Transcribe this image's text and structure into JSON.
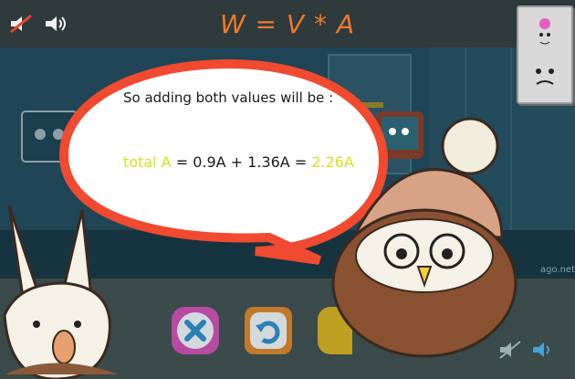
{
  "header": {
    "title": "W = V * A",
    "sound_mute_icon": "speaker-mute-icon",
    "sound_on_icon": "speaker-on-icon"
  },
  "dialog": {
    "line1": "So adding both values will be :",
    "equation": {
      "label": "total A",
      "middle": " = 0.9A + 1.36A = ",
      "result": "2.26A"
    }
  },
  "watermark": "ago.net",
  "controls": {
    "close_icon": "close-icon",
    "replay_icon": "replay-icon",
    "next_icon": "next-icon"
  },
  "colors": {
    "title": "#f07a2a",
    "bubble_border": "#f04a30",
    "highlight": "#d6e21a"
  }
}
